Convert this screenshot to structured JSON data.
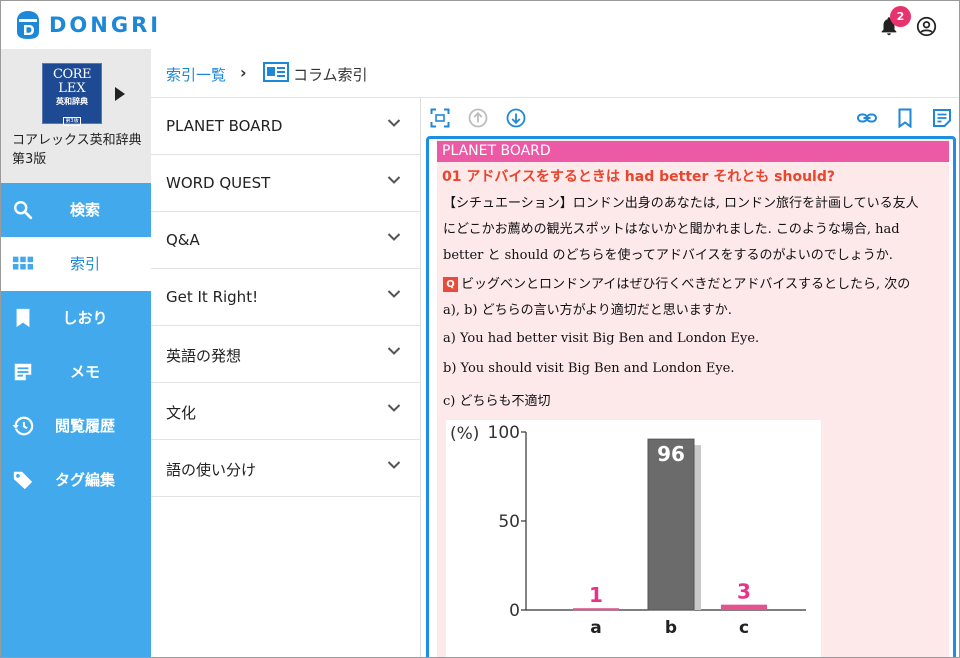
{
  "app": {
    "name": "DONGRI"
  },
  "notifications": {
    "count": "2"
  },
  "colors": {
    "accent": "#1e88d8",
    "sidebar": "#41a9ec",
    "badge": "#e8326e",
    "pb_header": "#ec5aa6",
    "title_red": "#e8452c",
    "page_bg": "#fde8ea"
  },
  "icons": {
    "logo": "dongri-logo-icon",
    "bell": "bell-icon",
    "account": "account-icon"
  },
  "dictionary": {
    "cover": {
      "line1": "CORE",
      "line2": "LEX",
      "line3": "英和辞典",
      "line4": "第3版"
    },
    "name": "コアレックス英和辞典 第3版"
  },
  "sidebar": {
    "items": [
      {
        "label": "検索",
        "icon": "search-icon",
        "active": false
      },
      {
        "label": "索引",
        "icon": "grid-icon",
        "active": true
      },
      {
        "label": "しおり",
        "icon": "bookmark-icon",
        "active": false
      },
      {
        "label": "メモ",
        "icon": "memo-icon",
        "active": false
      },
      {
        "label": "閲覧履歴",
        "icon": "history-icon",
        "active": false
      },
      {
        "label": "タグ編集",
        "icon": "tag-icon",
        "active": false
      }
    ]
  },
  "breadcrumb": {
    "root": "索引一覧",
    "current": "コラム索引"
  },
  "categories": [
    {
      "label": "PLANET BOARD"
    },
    {
      "label": "WORD QUEST"
    },
    {
      "label": "Q&A"
    },
    {
      "label": "Get It Right!"
    },
    {
      "label": "英語の発想"
    },
    {
      "label": "文化"
    },
    {
      "label": "語の使い分け"
    }
  ],
  "toolbar": {
    "left_icons": [
      "fit-screen-icon",
      "scroll-up-icon",
      "scroll-down-icon"
    ],
    "right_icons": [
      "link-icon",
      "bookmark-icon",
      "memo-icon"
    ]
  },
  "article": {
    "header": "PLANET BOARD",
    "title": "01 アドバイスをするときは had better それとも should?",
    "situation": [
      "【シチュエーション】ロンドン出身のあなたは, ロンドン旅行を計画している友人",
      "にどこかお薦めの観光スポットはないかと聞かれました. このような場合, had",
      "better と should のどちらを使ってアドバイスをするのがよいのでしょうか."
    ],
    "question_mark": "Q",
    "question": [
      "ビッグベンとロンドンアイはぜひ行くべきだとアドバイスするとしたら, 次の",
      "a), b) どちらの言い方がより適切だと思いますか."
    ],
    "options": [
      "a) You had better visit Big Ben and London Eye.",
      "b) You should visit Big Ben and London Eye.",
      "c) どちらも不適切"
    ]
  },
  "chart_data": {
    "type": "bar",
    "categories": [
      "a",
      "b",
      "c"
    ],
    "values": [
      1,
      96,
      3
    ],
    "value_labels": [
      "1",
      "96",
      "3"
    ],
    "ylabel": "(%)",
    "yticks": [
      0,
      50,
      100
    ],
    "ylim": [
      0,
      100
    ],
    "bar_colors": [
      "#e4528f",
      "#6b6b6b",
      "#e4528f"
    ],
    "label_colors": [
      "#e8328a",
      "#ffffff",
      "#e8328a"
    ]
  }
}
